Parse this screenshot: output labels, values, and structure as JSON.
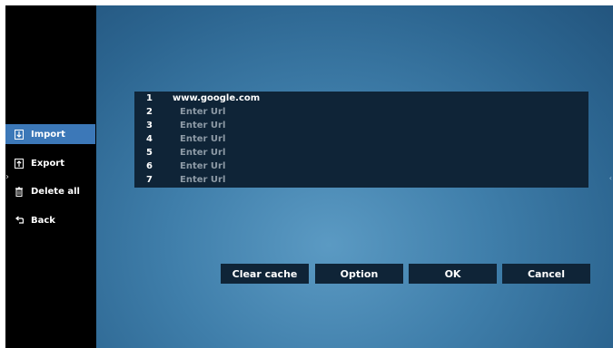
{
  "sidebar": {
    "items": [
      {
        "label": "Import",
        "icon": "import-icon",
        "active": true
      },
      {
        "label": "Export",
        "icon": "export-icon",
        "active": false
      },
      {
        "label": "Delete all",
        "icon": "trash-icon",
        "active": false
      },
      {
        "label": "Back",
        "icon": "back-icon",
        "active": false
      }
    ]
  },
  "url_list": {
    "rows": [
      {
        "num": "1",
        "value": "www.google.com",
        "placeholder": false
      },
      {
        "num": "2",
        "value": "Enter Url",
        "placeholder": true
      },
      {
        "num": "3",
        "value": "Enter Url",
        "placeholder": true
      },
      {
        "num": "4",
        "value": "Enter Url",
        "placeholder": true
      },
      {
        "num": "5",
        "value": "Enter Url",
        "placeholder": true
      },
      {
        "num": "6",
        "value": "Enter Url",
        "placeholder": true
      },
      {
        "num": "7",
        "value": "Enter Url",
        "placeholder": true
      }
    ]
  },
  "buttons": {
    "clear_cache": "Clear cache",
    "option": "Option",
    "ok": "OK",
    "cancel": "Cancel"
  },
  "colors": {
    "active_item": "#3c78b8",
    "panel": "#0f2437",
    "placeholder_text": "#8d9aa6"
  }
}
